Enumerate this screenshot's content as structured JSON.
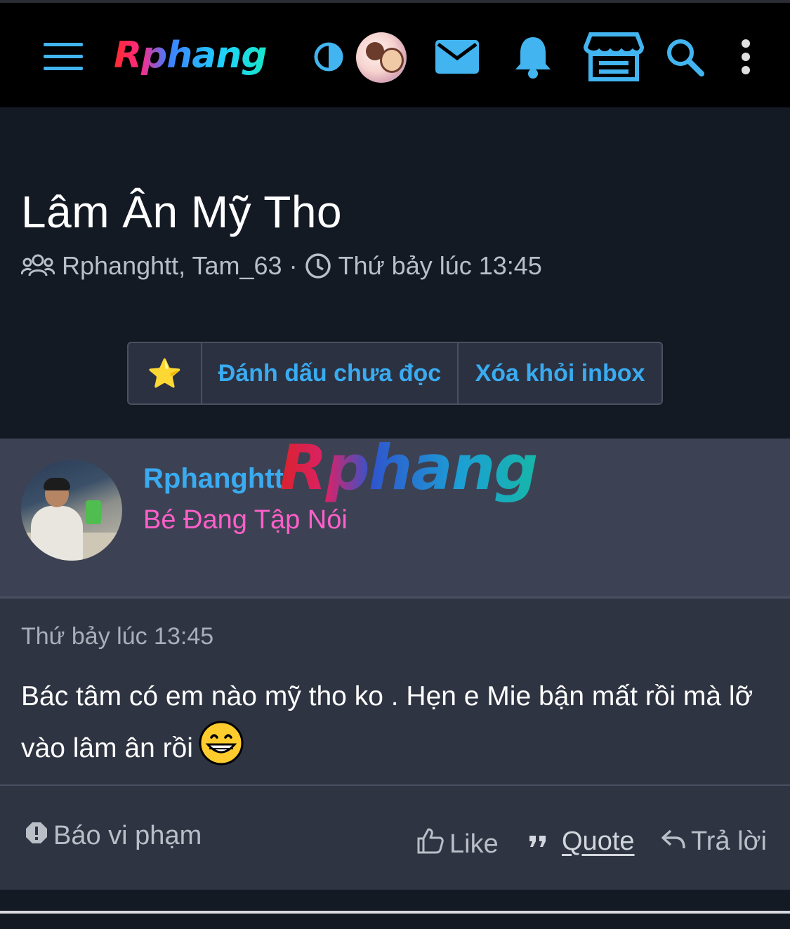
{
  "topbar": {
    "logo_text": "Rphang",
    "icons": [
      "menu-icon",
      "contrast-icon",
      "avatar",
      "mail-icon",
      "bell-icon",
      "store-icon",
      "search-icon",
      "more-vertical-icon"
    ],
    "accent_color": "#42b4ef"
  },
  "conversation": {
    "title": "Lâm Ân Mỹ Tho",
    "participants": "Rphanghtt, Tam_63",
    "separator": "·",
    "time": "Thứ bảy lúc 13:45"
  },
  "buttons": {
    "star_glyph": "⭐",
    "mark_unread": "Đánh dấu chưa đọc",
    "remove_inbox": "Xóa khỏi inbox"
  },
  "post": {
    "username": "Rphanghtt",
    "user_title": "Bé Đang Tập Nói",
    "watermark": "Rphang",
    "time": "Thứ bảy lúc 13:45",
    "body": "Bác tâm có em nào mỹ tho ko . Hẹn e Mie bận mất rồi mà lỡ vào lâm ân rồi",
    "emoji": "grinning-face"
  },
  "actions": {
    "report": "Báo vi phạm",
    "like": "Like",
    "quote": "Quote",
    "reply": "Trả lời"
  },
  "colors": {
    "link_blue": "#3aabf0",
    "user_title_pink": "#ff5fc8",
    "background": "#141a24",
    "card": "#2f3442",
    "user_panel": "#3c4254"
  }
}
